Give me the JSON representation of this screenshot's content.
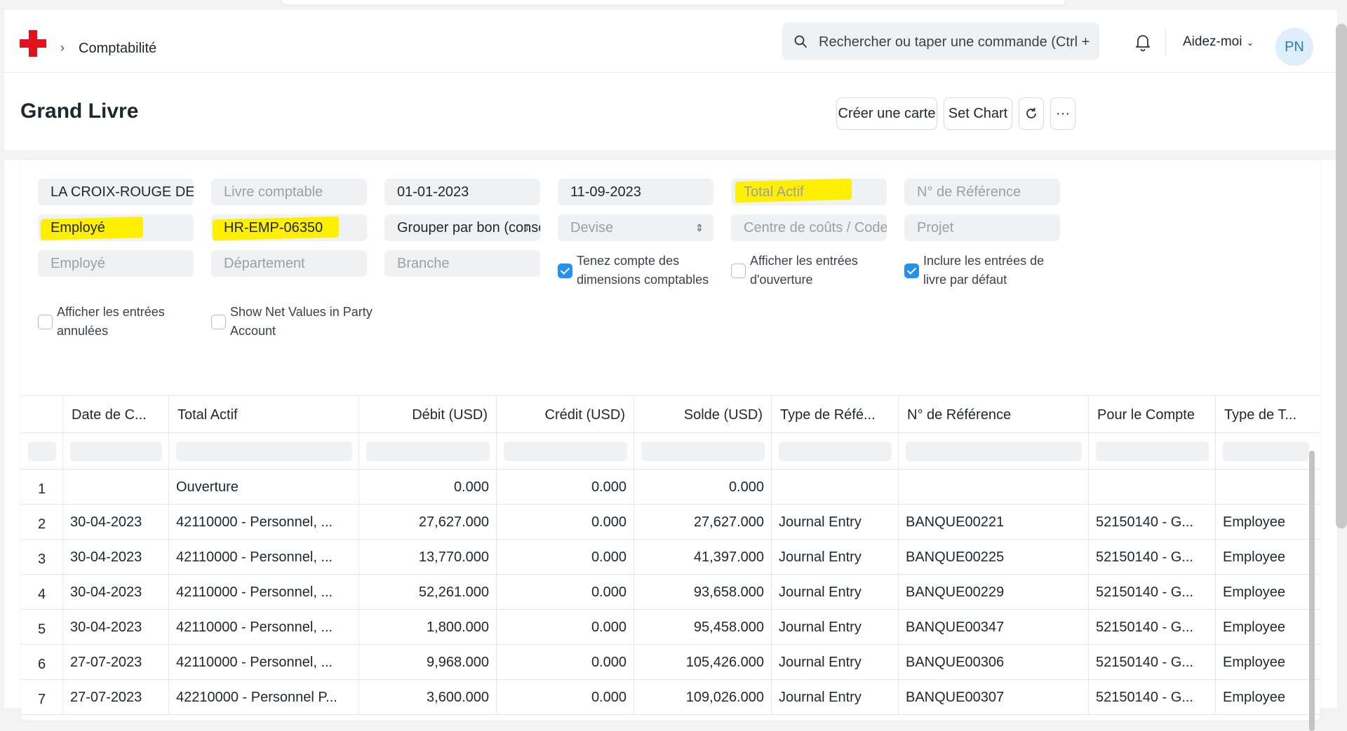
{
  "navbar": {
    "breadcrumb": "Comptabilité",
    "search_placeholder": "Rechercher ou taper une commande (Ctrl + G)",
    "help_label": "Aidez-moi",
    "avatar_initials": "PN"
  },
  "page": {
    "title": "Grand Livre",
    "create_card_label": "Créer une carte",
    "set_chart_label": "Set Chart"
  },
  "filters": {
    "company": "LA CROIX-ROUGE DE LA RDC",
    "ledger_placeholder": "Livre comptable",
    "from_date": "01-01-2023",
    "to_date": "11-09-2023",
    "account_placeholder": "Total Actif",
    "reference_placeholder": "N° de Référence",
    "party_type": "Employé",
    "party": "HR-EMP-06350",
    "group_by": "Grouper par bon (consolidé)",
    "currency_placeholder": "Devise",
    "cost_center_placeholder": "Centre de coûts / Code Bailleur",
    "project_placeholder": "Projet",
    "employee_placeholder": "Employé",
    "department_placeholder": "Département",
    "branch_placeholder": "Branche",
    "checkboxes": [
      {
        "label": "Tenez compte des dimensions comptables",
        "checked": true
      },
      {
        "label": "Afficher les entrées d'ouverture",
        "checked": false
      },
      {
        "label": "Inclure les entrées de livre par défaut",
        "checked": true
      },
      {
        "label": "Afficher les entrées annulées",
        "checked": false
      },
      {
        "label": "Show Net Values in Party Account",
        "checked": false
      }
    ]
  },
  "table": {
    "columns": [
      "Date de C...",
      "Total Actif",
      "Débit (USD)",
      "Crédit (USD)",
      "Solde (USD)",
      "Type de Réfé...",
      "N° de Référence",
      "Pour le Compte",
      "Type de T..."
    ],
    "rows": [
      {
        "n": "1",
        "date": "",
        "account": "Ouverture",
        "debit": "0.000",
        "credit": "0.000",
        "balance": "0.000",
        "ref_type": "",
        "ref_no": "",
        "against": "",
        "party_type": ""
      },
      {
        "n": "2",
        "date": "30-04-2023",
        "account": "42110000 - Personnel, ...",
        "debit": "27,627.000",
        "credit": "0.000",
        "balance": "27,627.000",
        "ref_type": "Journal Entry",
        "ref_no": "BANQUE00221",
        "against": "52150140 - G...",
        "party_type": "Employee"
      },
      {
        "n": "3",
        "date": "30-04-2023",
        "account": "42110000 - Personnel, ...",
        "debit": "13,770.000",
        "credit": "0.000",
        "balance": "41,397.000",
        "ref_type": "Journal Entry",
        "ref_no": "BANQUE00225",
        "against": "52150140 - G...",
        "party_type": "Employee"
      },
      {
        "n": "4",
        "date": "30-04-2023",
        "account": "42110000 - Personnel, ...",
        "debit": "52,261.000",
        "credit": "0.000",
        "balance": "93,658.000",
        "ref_type": "Journal Entry",
        "ref_no": "BANQUE00229",
        "against": "52150140 - G...",
        "party_type": "Employee"
      },
      {
        "n": "5",
        "date": "30-04-2023",
        "account": "42110000 - Personnel, ...",
        "debit": "1,800.000",
        "credit": "0.000",
        "balance": "95,458.000",
        "ref_type": "Journal Entry",
        "ref_no": "BANQUE00347",
        "against": "52150140 - G...",
        "party_type": "Employee"
      },
      {
        "n": "6",
        "date": "27-07-2023",
        "account": "42110000 - Personnel, ...",
        "debit": "9,968.000",
        "credit": "0.000",
        "balance": "105,426.000",
        "ref_type": "Journal Entry",
        "ref_no": "BANQUE00306",
        "against": "52150140 - G...",
        "party_type": "Employee"
      },
      {
        "n": "7",
        "date": "27-07-2023",
        "account": "42210000 - Personnel P...",
        "debit": "3,600.000",
        "credit": "0.000",
        "balance": "109,026.000",
        "ref_type": "Journal Entry",
        "ref_no": "BANQUE00307",
        "against": "52150140 - G...",
        "party_type": "Employee"
      }
    ]
  },
  "colors": {
    "accent": "#2490ef",
    "brand": "#e0121b",
    "highlight": "#ffef00"
  }
}
